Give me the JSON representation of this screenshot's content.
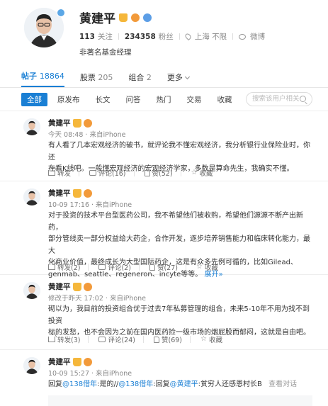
{
  "profile": {
    "name": "黄建平",
    "following_count": "113",
    "following_label": "关注",
    "followers_count": "234358",
    "followers_label": "粉丝",
    "location": "上海 不限",
    "weibo_label": "微博",
    "title": "非著名基金经理"
  },
  "tabs": [
    {
      "label": "帖子",
      "count": "18864"
    },
    {
      "label": "股票",
      "count": "205"
    },
    {
      "label": "组合",
      "count": "2"
    },
    {
      "label": "更多",
      "count": ""
    }
  ],
  "filters": [
    "全部",
    "原发布",
    "长文",
    "问答",
    "热门",
    "交易",
    "收藏"
  ],
  "search": {
    "placeholder": "搜索该用户相关"
  },
  "posts": [
    {
      "name": "黄建平",
      "meta": "今天 08:48 · 来自iPhone",
      "lines": [
        "有人看了几本宏观经济的破书，就评论我不懂宏观经济，我分析银行业保险业时，你还",
        "在看K线吧。一般懂宏观经济的宏观经济学家，多数是算命先生，我确实不懂。"
      ],
      "repost": "转发",
      "comment": "评论(16)",
      "like": "赞(52)",
      "fav": "收藏"
    },
    {
      "name": "黄建平",
      "meta": "10-09 17:16 · 来自iPhone",
      "lines": [
        "对于投资的技术平台型医药公司，我不希望他们被收购，希望他们源源不断产出新药，",
        "部分管线卖一部分权益给大药企，合作开发，逐步培养销售能力和临床转化能力，最大",
        "化商业价值，最终成长为大型国际药企，这是有众多先例可循的，比如Gilead、",
        "genmab、seattle、regeneron、incyte等等。"
      ],
      "expand": "展开",
      "repost": "转发(2)",
      "comment": "评论(2)",
      "like": "赞(27)",
      "fav": "收藏"
    },
    {
      "name": "黄建平",
      "meta": "修改于昨天 17:02 · 来自iPhone",
      "lines": [
        "砌以为，我目前的投资组合优于过去7年私募管理的组合，未来5-10年不用为找不到投资",
        "标的发愁，也不会因为之前在国内医药捡一级市场的烟屁股而郁闷，这就是自由吧。"
      ],
      "repost": "转发(3)",
      "comment": "评论(24)",
      "like": "赞(69)",
      "fav": "收藏"
    },
    {
      "name": "黄建平",
      "meta": "10-09 15:27 · 来自iPhone",
      "reply": {
        "prefix": "回复",
        "mention1": "@138借年",
        "mid1": ":是的//",
        "mention2": "@138借年",
        "mid2": ":回复",
        "mention3": "@黄建平",
        "tail": ":贫穷人还感恩村长B",
        "view": "查看对话"
      }
    }
  ],
  "colors": {
    "accent": "#1a7fd4",
    "medal_gold": "#f5b73b",
    "medal_orange": "#f29a3a",
    "medal_blue": "#5c9ee6"
  }
}
